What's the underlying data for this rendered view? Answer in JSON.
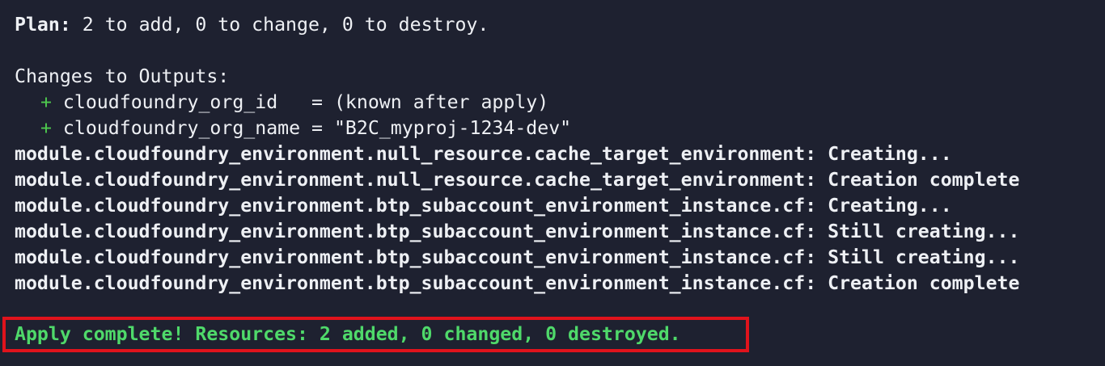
{
  "plan": {
    "label": "Plan:",
    "text": " 2 to add, 0 to change, 0 to destroy."
  },
  "outputs": {
    "heading": "Changes to Outputs:",
    "items": [
      {
        "sign": "+",
        "text": " cloudfoundry_org_id   = (known after apply)"
      },
      {
        "sign": "+",
        "text": " cloudfoundry_org_name = \"B2C_myproj-1234-dev\""
      }
    ]
  },
  "log_lines": [
    "module.cloudfoundry_environment.null_resource.cache_target_environment: Creating...",
    "module.cloudfoundry_environment.null_resource.cache_target_environment: Creation complete",
    "module.cloudfoundry_environment.btp_subaccount_environment_instance.cf: Creating...",
    "module.cloudfoundry_environment.btp_subaccount_environment_instance.cf: Still creating...",
    "module.cloudfoundry_environment.btp_subaccount_environment_instance.cf: Still creating...",
    "module.cloudfoundry_environment.btp_subaccount_environment_instance.cf: Creation complete"
  ],
  "apply_result": "Apply complete! Resources: 2 added, 0 changed, 0 destroyed.",
  "colors": {
    "background": "#1e2130",
    "text": "#eef0f4",
    "plus": "#4ec94e",
    "success": "#4fd96a",
    "highlight": "#e0131c"
  }
}
